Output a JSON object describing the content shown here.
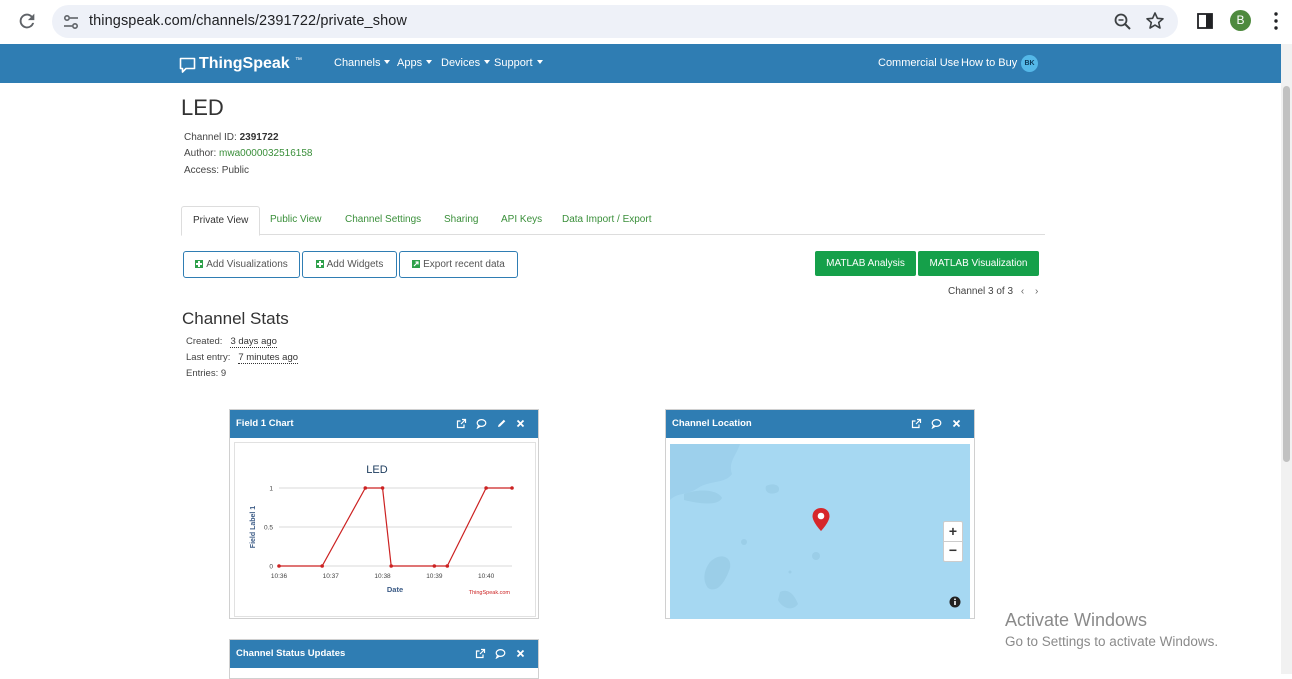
{
  "browser": {
    "url": "thingspeak.com/channels/2391722/private_show",
    "profile_initial": "B"
  },
  "navbar": {
    "brand": "ThingSpeak",
    "brand_tm": "™",
    "menu": [
      {
        "label": "Channels"
      },
      {
        "label": "Apps"
      },
      {
        "label": "Devices"
      },
      {
        "label": "Support"
      }
    ],
    "commercial_use": "Commercial Use",
    "how_to_buy": "How to Buy",
    "user_initials": "BK"
  },
  "channel": {
    "title": "LED",
    "id_label": "Channel ID: ",
    "id_value": "2391722",
    "author_label": "Author: ",
    "author_value": "mwa0000032516158",
    "access_label": "Access: ",
    "access_value": "Public"
  },
  "tabs": [
    {
      "label": "Private View",
      "active": true
    },
    {
      "label": "Public View"
    },
    {
      "label": "Channel Settings"
    },
    {
      "label": "Sharing"
    },
    {
      "label": "API Keys"
    },
    {
      "label": "Data Import / Export"
    }
  ],
  "actions": {
    "add_visualizations": "Add Visualizations",
    "add_widgets": "Add Widgets",
    "export_recent": "Export recent data",
    "matlab_analysis": "MATLAB Analysis",
    "matlab_visualization": "MATLAB Visualization"
  },
  "channel_nav": "Channel 3 of 3",
  "stats": {
    "title": "Channel Stats",
    "created_label": "Created:",
    "created_value": "3 days ago",
    "last_entry_label": "Last entry:",
    "last_entry_value": "7 minutes ago",
    "entries_label": "Entries: ",
    "entries_value": "9"
  },
  "widgets": {
    "field1": {
      "title": "Field 1 Chart"
    },
    "location": {
      "title": "Channel Location"
    },
    "status": {
      "title": "Channel Status Updates"
    }
  },
  "chart_data": {
    "type": "line",
    "title": "LED",
    "xlabel": "Date",
    "ylabel": "Field Label 1",
    "x_ticks": [
      "10:36",
      "10:37",
      "10:38",
      "10:39",
      "10:40"
    ],
    "y_ticks": [
      "0",
      "0.5",
      "1"
    ],
    "ylim": [
      0,
      1
    ],
    "xlim": [
      "10:36",
      "10:40:30"
    ],
    "series": [
      {
        "color": "#cc2222",
        "points": [
          {
            "x": "10:36:00",
            "y": 0
          },
          {
            "x": "10:36:50",
            "y": 0
          },
          {
            "x": "10:37:40",
            "y": 1
          },
          {
            "x": "10:38:00",
            "y": 1
          },
          {
            "x": "10:38:10",
            "y": 0
          },
          {
            "x": "10:39:00",
            "y": 0
          },
          {
            "x": "10:39:15",
            "y": 0
          },
          {
            "x": "10:40:00",
            "y": 1
          },
          {
            "x": "10:40:30",
            "y": 1
          }
        ]
      }
    ],
    "credit": "ThingSpeak.com"
  },
  "watermark": {
    "line1": "Activate Windows",
    "line2": "Go to Settings to activate Windows."
  }
}
